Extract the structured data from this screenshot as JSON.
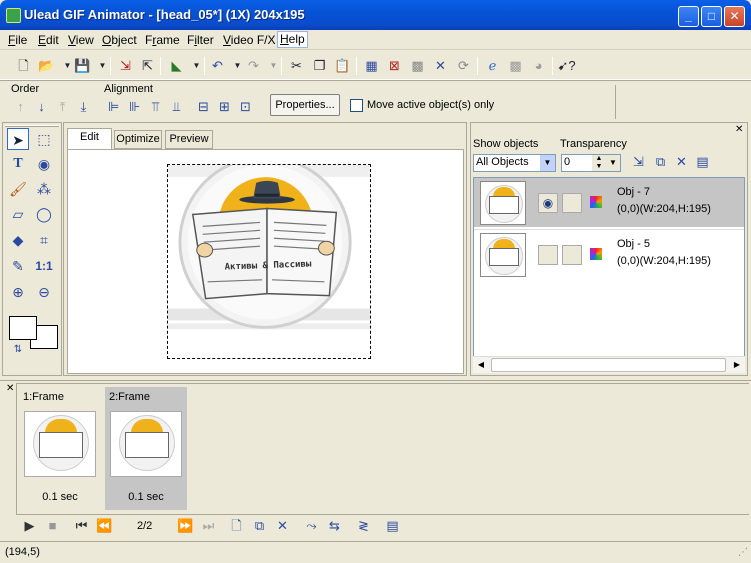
{
  "window": {
    "title": "Ulead GIF Animator - [head_05*] (1X) 204x195"
  },
  "menu": [
    {
      "label": "File",
      "u": "F",
      "rest": "ile"
    },
    {
      "label": "Edit",
      "u": "E",
      "rest": "dit"
    },
    {
      "label": "View",
      "u": "V",
      "rest": "iew"
    },
    {
      "label": "Object",
      "u": "O",
      "rest": "bject"
    },
    {
      "label": "Frame",
      "u": "r",
      "pre": "F",
      "rest": "ame"
    },
    {
      "label": "Filter",
      "u": "i",
      "pre": "F",
      "rest": "lter"
    },
    {
      "label": "Video F/X",
      "u": "V",
      "rest": "ideo F/X"
    },
    {
      "label": "Help",
      "u": "H",
      "rest": "elp"
    }
  ],
  "align": {
    "order_label": "Order",
    "alignment_label": "Alignment",
    "properties_label": "Properties...",
    "move_active_label": "Move active object(s) only"
  },
  "tabs": [
    "Edit",
    "Optimize",
    "Preview"
  ],
  "objects": {
    "show_label": "Show objects",
    "transparency_label": "Transparency",
    "show_value": "All Objects",
    "transparency_value": "0",
    "items": [
      {
        "name": "Obj - 7",
        "info": "(0,0)(W:204,H:195)"
      },
      {
        "name": "Obj - 5",
        "info": "(0,0)(W:204,H:195)"
      }
    ]
  },
  "frames": {
    "items": [
      {
        "label": "1:Frame",
        "delay": "0.1 sec"
      },
      {
        "label": "2:Frame",
        "delay": "0.1 sec"
      }
    ],
    "counter": "2/2"
  },
  "image_text": "Активы & Пассивы",
  "status": {
    "coords": "(194,5)"
  },
  "colors": {
    "title_bar": "#0653d6",
    "selection": "#c5c5c5",
    "accent_orange": "#f0b21a"
  }
}
